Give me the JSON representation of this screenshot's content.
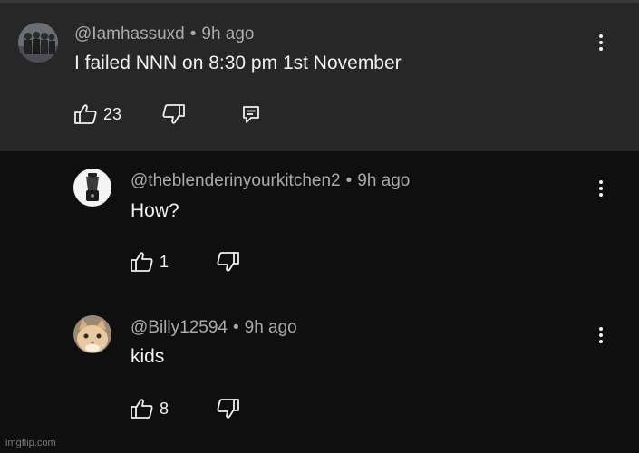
{
  "comments": [
    {
      "handle": "@Iamhassuxd",
      "separator": "•",
      "time": "9h ago",
      "text": "I failed NNN on 8:30 pm 1st November",
      "likes": "23",
      "avatar_icon": "group-photo-avatar-icon"
    },
    {
      "handle": "@theblenderinyourkitchen2",
      "separator": "•",
      "time": "9h ago",
      "text": "How?",
      "likes": "1",
      "avatar_icon": "blender-avatar-icon"
    },
    {
      "handle": "@Billy12594",
      "separator": "•",
      "time": "9h ago",
      "text": "kids",
      "likes": "8",
      "avatar_icon": "cat-avatar-icon"
    }
  ],
  "watermark": "imgflip.com",
  "colors": {
    "background": "#0f0f0f",
    "highlighted_comment": "#272727",
    "meta_text": "#aaaaaa",
    "text": "#f1f1f1"
  }
}
